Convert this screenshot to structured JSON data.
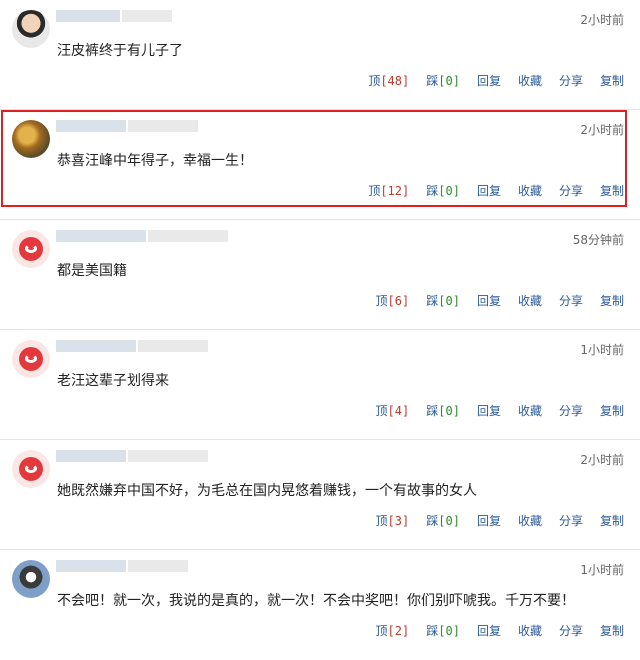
{
  "comments": [
    {
      "time": "2小时前",
      "text": "汪皮裤终于有儿子了",
      "up_label": "顶",
      "up_count": "[48]",
      "down_label": "踩",
      "down_count": "[0]",
      "reply": "回复",
      "fav": "收藏",
      "share": "分享",
      "copy": "复制"
    },
    {
      "time": "2小时前",
      "text": "恭喜汪峰中年得子，幸福一生！",
      "up_label": "顶",
      "up_count": "[12]",
      "down_label": "踩",
      "down_count": "[0]",
      "reply": "回复",
      "fav": "收藏",
      "share": "分享",
      "copy": "复制"
    },
    {
      "time": "58分钟前",
      "text": "都是美国籍",
      "up_label": "顶",
      "up_count": "[6]",
      "down_label": "踩",
      "down_count": "[0]",
      "reply": "回复",
      "fav": "收藏",
      "share": "分享",
      "copy": "复制"
    },
    {
      "time": "1小时前",
      "text": "老汪这辈子划得来",
      "up_label": "顶",
      "up_count": "[4]",
      "down_label": "踩",
      "down_count": "[0]",
      "reply": "回复",
      "fav": "收藏",
      "share": "分享",
      "copy": "复制"
    },
    {
      "time": "2小时前",
      "text": "她既然嫌弃中国不好，为毛总在国内晃悠着赚钱，一个有故事的女人",
      "up_label": "顶",
      "up_count": "[3]",
      "down_label": "踩",
      "down_count": "[0]",
      "reply": "回复",
      "fav": "收藏",
      "share": "分享",
      "copy": "复制"
    },
    {
      "time": "1小时前",
      "text": "不会吧！就一次，我说的是真的，就一次！不会中奖吧！你们别吓唬我。千万不要！",
      "up_label": "顶",
      "up_count": "[2]",
      "down_label": "踩",
      "down_count": "[0]",
      "reply": "回复",
      "fav": "收藏",
      "share": "分享",
      "copy": "复制"
    }
  ],
  "colors": {
    "action_link": "#2b5b9e",
    "up_count": "#c0392b",
    "down_count": "#2e8b2e",
    "highlight_border": "#e02020"
  }
}
